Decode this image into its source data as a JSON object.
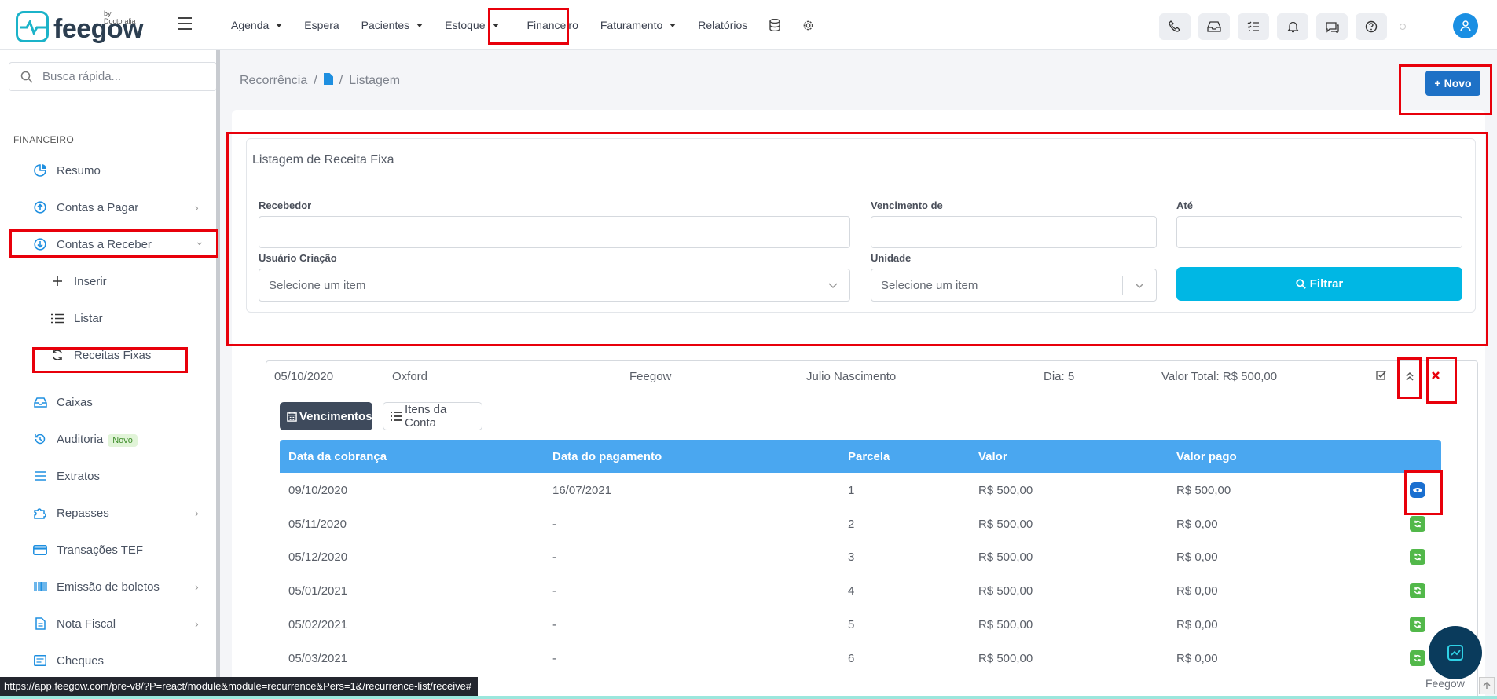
{
  "brand": {
    "name": "feegow",
    "by": "by Doctoralia"
  },
  "nav": {
    "items": [
      {
        "label": "Agenda",
        "dropdown": true
      },
      {
        "label": "Espera",
        "dropdown": false
      },
      {
        "label": "Pacientes",
        "dropdown": true
      },
      {
        "label": "Estoque",
        "dropdown": true
      },
      {
        "label": "Financeiro",
        "dropdown": false
      },
      {
        "label": "Faturamento",
        "dropdown": true
      },
      {
        "label": "Relatórios",
        "dropdown": false
      }
    ],
    "icons": [
      "database-icon",
      "gear-icon"
    ]
  },
  "topicons": [
    "phone-icon",
    "inbox-icon",
    "checklist-icon",
    "bell-icon",
    "chat-icon",
    "help-icon"
  ],
  "sidebar": {
    "search_placeholder": "Busca rápida...",
    "heading": "FINANCEIRO",
    "items": [
      {
        "label": "Resumo",
        "icon": "pie-chart-icon"
      },
      {
        "label": "Contas a Pagar",
        "icon": "arrow-up-circle-icon",
        "chevron": "›"
      },
      {
        "label": "Contas a Receber",
        "icon": "arrow-down-circle-icon",
        "chevron": "⌄"
      },
      {
        "label": "Inserir",
        "icon": "plus-icon"
      },
      {
        "label": "Listar",
        "icon": "list-icon"
      },
      {
        "label": "Receitas Fixas",
        "icon": "refresh-icon"
      },
      {
        "label": "Caixas",
        "icon": "inbox-icon"
      },
      {
        "label": "Auditoria",
        "icon": "history-icon",
        "badge": "Novo"
      },
      {
        "label": "Extratos",
        "icon": "lines-icon"
      },
      {
        "label": "Repasses",
        "icon": "puzzle-icon",
        "chevron": "›"
      },
      {
        "label": "Transações TEF",
        "icon": "credit-card-icon"
      },
      {
        "label": "Emissão de boletos",
        "icon": "barcode-icon",
        "chevron": "›"
      },
      {
        "label": "Nota Fiscal",
        "icon": "document-icon",
        "chevron": "›"
      },
      {
        "label": "Cheques",
        "icon": "cheque-icon"
      }
    ]
  },
  "breadcrumb": {
    "first": "Recorrência",
    "sep": "/",
    "last": "Listagem"
  },
  "novo_button": "Novo",
  "filter": {
    "title": "Listagem de Receita Fixa",
    "recebedor_label": "Recebedor",
    "vencimento_label": "Vencimento de",
    "ate_label": "Até",
    "usuario_label": "Usuário Criação",
    "usuario_placeholder": "Selecione um item",
    "unidade_label": "Unidade",
    "unidade_placeholder": "Selecione um item",
    "filtrar_label": "Filtrar"
  },
  "record": {
    "date": "05/10/2020",
    "unit": "Oxford",
    "company": "Feegow",
    "person": "Julio Nascimento",
    "day": "Dia: 5",
    "total": "Valor Total: R$ 500,00"
  },
  "tabs": {
    "vencimentos": "Vencimentos",
    "itens": "Itens da Conta"
  },
  "table": {
    "headers": [
      "Data da cobrança",
      "Data do pagamento",
      "Parcela",
      "Valor",
      "Valor pago"
    ],
    "rows": [
      {
        "cobranca": "09/10/2020",
        "pagamento": "16/07/2021",
        "parcela": "1",
        "valor": "R$ 500,00",
        "pago": "R$ 500,00",
        "action": "view"
      },
      {
        "cobranca": "05/11/2020",
        "pagamento": "-",
        "parcela": "2",
        "valor": "R$ 500,00",
        "pago": "R$ 0,00",
        "action": "refresh"
      },
      {
        "cobranca": "05/12/2020",
        "pagamento": "-",
        "parcela": "3",
        "valor": "R$ 500,00",
        "pago": "R$ 0,00",
        "action": "refresh"
      },
      {
        "cobranca": "05/01/2021",
        "pagamento": "-",
        "parcela": "4",
        "valor": "R$ 500,00",
        "pago": "R$ 0,00",
        "action": "refresh"
      },
      {
        "cobranca": "05/02/2021",
        "pagamento": "-",
        "parcela": "5",
        "valor": "R$ 500,00",
        "pago": "R$ 0,00",
        "action": "refresh"
      },
      {
        "cobranca": "05/03/2021",
        "pagamento": "-",
        "parcela": "6",
        "valor": "R$ 500,00",
        "pago": "R$ 0,00",
        "action": "refresh"
      }
    ]
  },
  "status_url": "https://app.feegow.com/pre-v8/?P=react/module&module=recurrence&Pers=1&/recurrence-list/receive#",
  "footer_brand": "Feegow",
  "colors": {
    "accent": "#1e71c6",
    "filter": "#00b7e4",
    "table_head": "#4aa7f0",
    "highlight": "#e8000b"
  }
}
